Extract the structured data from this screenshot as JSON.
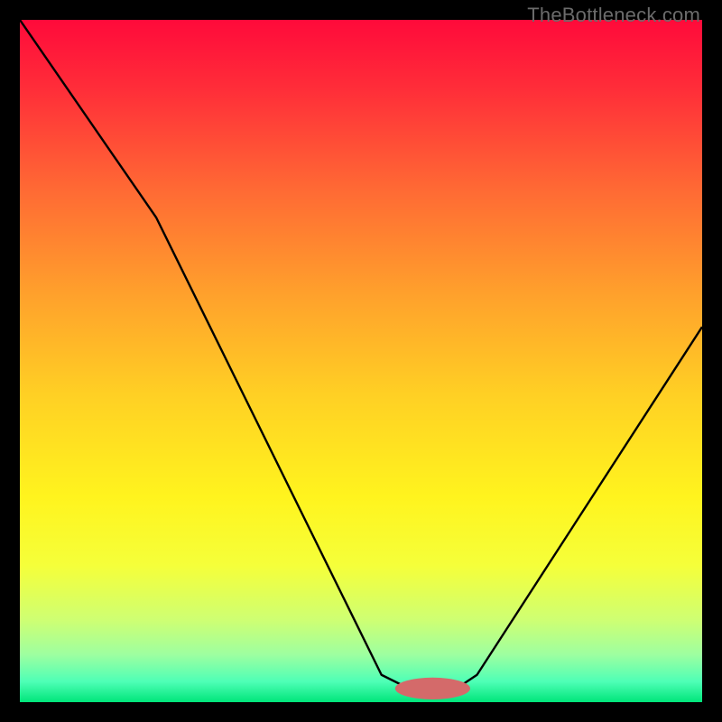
{
  "watermark": "TheBottleneck.com",
  "chart_data": {
    "type": "line",
    "title": "",
    "xlabel": "",
    "ylabel": "",
    "xlim": [
      0,
      100
    ],
    "ylim": [
      0,
      100
    ],
    "grid": false,
    "curve": [
      {
        "x": 0,
        "y": 100
      },
      {
        "x": 20,
        "y": 71
      },
      {
        "x": 53,
        "y": 4
      },
      {
        "x": 57,
        "y": 2
      },
      {
        "x": 64,
        "y": 2
      },
      {
        "x": 67,
        "y": 4
      },
      {
        "x": 100,
        "y": 55
      }
    ],
    "background_gradient_stops": [
      {
        "pos": 0.0,
        "color": "#ff0a3a"
      },
      {
        "pos": 0.1,
        "color": "#ff2d39"
      },
      {
        "pos": 0.25,
        "color": "#ff6a34"
      },
      {
        "pos": 0.4,
        "color": "#ffa02c"
      },
      {
        "pos": 0.55,
        "color": "#ffd024"
      },
      {
        "pos": 0.7,
        "color": "#fff41e"
      },
      {
        "pos": 0.8,
        "color": "#f5ff3a"
      },
      {
        "pos": 0.88,
        "color": "#ceff73"
      },
      {
        "pos": 0.93,
        "color": "#9effa0"
      },
      {
        "pos": 0.97,
        "color": "#4effb6"
      },
      {
        "pos": 1.0,
        "color": "#00e57a"
      }
    ],
    "marker": {
      "x": 60.5,
      "y": 2,
      "rx": 5.5,
      "ry": 1.6,
      "fill": "#d46a6a"
    }
  }
}
